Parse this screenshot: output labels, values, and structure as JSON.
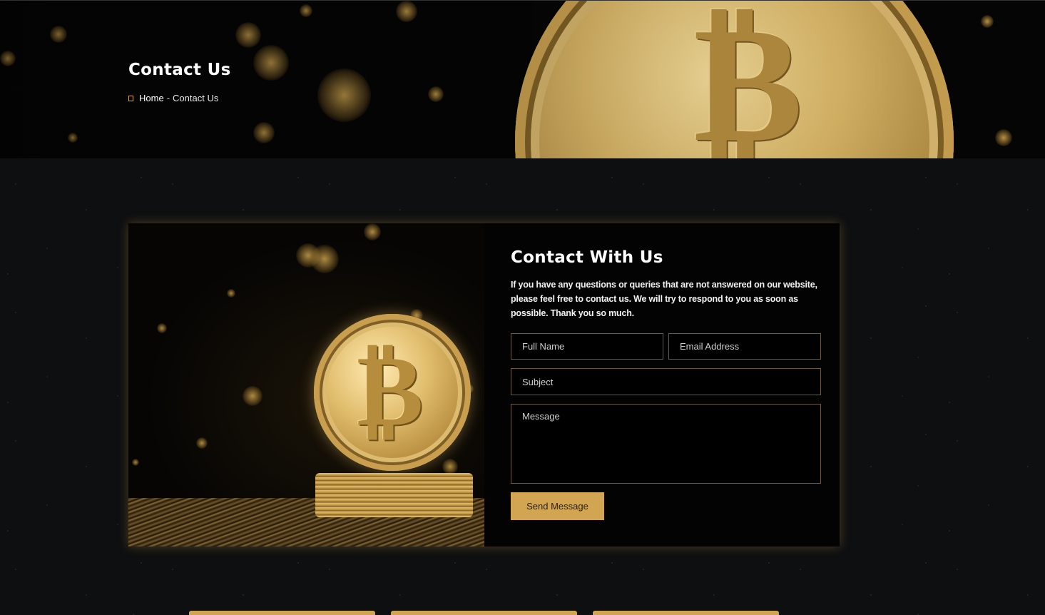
{
  "hero": {
    "title": "Contact Us",
    "breadcrumb": {
      "home_icon": "home-icon",
      "home_label": "Home",
      "separator": "-",
      "current_label": "Contact Us"
    }
  },
  "contact": {
    "title": "Contact With Us",
    "description": "If you have any questions or queries that are not answered on our website, please feel free to contact us. We will try to respond to you as soon as possible. Thank you so much.",
    "form": {
      "full_name_placeholder": "Full Name",
      "email_placeholder": "Email Address",
      "subject_placeholder": "Subject",
      "message_placeholder": "Message",
      "submit_label": "Send Message"
    }
  },
  "colors": {
    "accent": "#d1a552",
    "background": "#0e0f11",
    "card_background": "#030303",
    "field_border": "#6d5a35"
  }
}
